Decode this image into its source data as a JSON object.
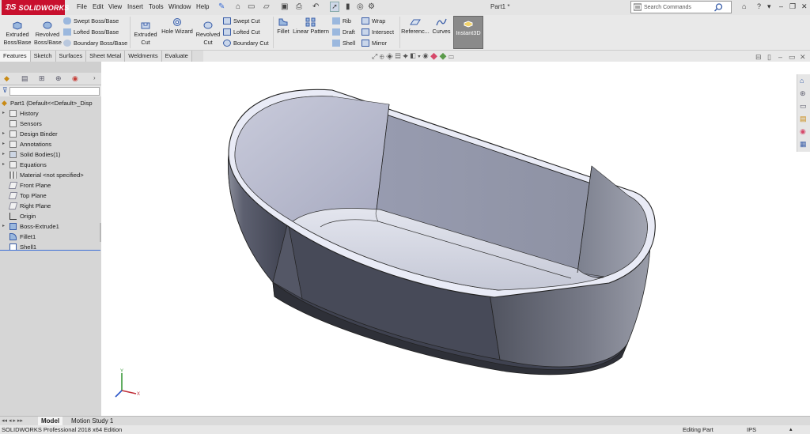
{
  "app": {
    "brand": "SOLIDWORKS",
    "title": "Part1 *"
  },
  "menu": [
    "File",
    "Edit",
    "View",
    "Insert",
    "Tools",
    "Window",
    "Help"
  ],
  "search": {
    "placeholder": "Search Commands"
  },
  "ribbon": {
    "extruded_boss": "Extruded Boss/Base",
    "revolved_boss": "Revolved Boss/Base",
    "swept_boss": "Swept Boss/Base",
    "lofted_boss": "Lofted Boss/Base",
    "boundary_boss": "Boundary Boss/Base",
    "extruded_cut": "Extruded Cut",
    "hole_wizard": "Hole Wizard",
    "revolved_cut": "Revolved Cut",
    "swept_cut": "Swept Cut",
    "lofted_cut": "Lofted Cut",
    "boundary_cut": "Boundary Cut",
    "fillet": "Fillet",
    "linear_pattern": "Linear Pattern",
    "rib": "Rib",
    "draft": "Draft",
    "shell": "Shell",
    "wrap": "Wrap",
    "intersect": "Intersect",
    "mirror": "Mirror",
    "reference": "Referenc...",
    "curves": "Curves",
    "instant3d": "Instant3D"
  },
  "tabs": [
    "Features",
    "Sketch",
    "Surfaces",
    "Sheet Metal",
    "Weldments",
    "Evaluate"
  ],
  "tree": {
    "root": "Part1  (Default<<Default>_Disp",
    "items": [
      "History",
      "Sensors",
      "Design Binder",
      "Annotations",
      "Solid Bodies(1)",
      "Equations",
      "Material <not specified>",
      "Front Plane",
      "Top Plane",
      "Right Plane",
      "Origin",
      "Boss-Extrude1",
      "Fillet1",
      "Shell1"
    ]
  },
  "bottom": {
    "model": "Model",
    "motion": "Motion Study 1"
  },
  "status": {
    "edition": "SOLIDWORKS Professional 2018 x64 Edition",
    "mode": "Editing Part",
    "units": "IPS"
  },
  "colors": {
    "brand": "#c8102e",
    "panel": "#d6d6d6",
    "accent": "#3d6fd6"
  }
}
